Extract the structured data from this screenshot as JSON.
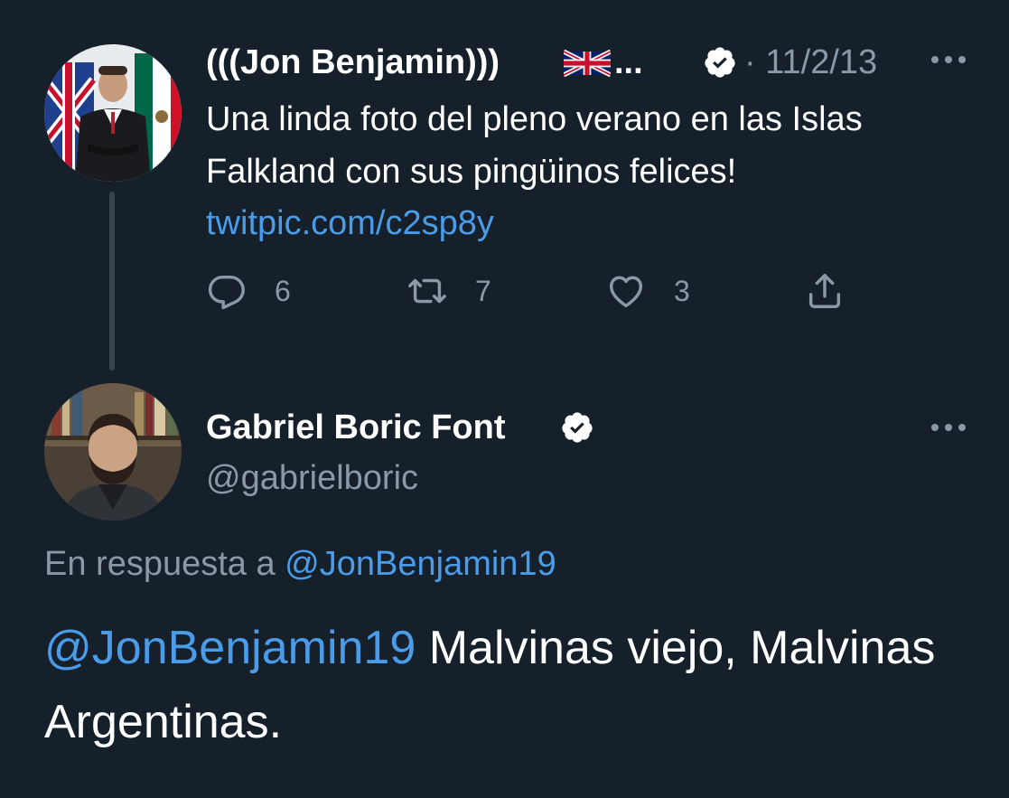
{
  "colors": {
    "background": "#15202b",
    "text_primary": "#ffffff",
    "text_secondary": "#8b98a5",
    "link": "#4a9ce8",
    "thread_line": "#38444d"
  },
  "parent_tweet": {
    "author_name": "(((Jon Benjamin)))",
    "name_flag_icon": "uk-flag-emoji",
    "name_ellipsis": "...",
    "verified_icon": "verified-badge-icon",
    "date": "· 11/2/13",
    "text": "Una linda foto del pleno verano en las Islas Falkland con sus pingüinos felices!",
    "link": "twitpic.com/c2sp8y",
    "actions": {
      "reply": {
        "icon": "reply-icon",
        "count": "6"
      },
      "retweet": {
        "icon": "retweet-icon",
        "count": "7"
      },
      "like": {
        "icon": "heart-icon",
        "count": "3"
      },
      "share": {
        "icon": "share-icon"
      }
    }
  },
  "reply_tweet": {
    "author_name": "Gabriel Boric Font",
    "handle": "@gabrielboric",
    "in_reply_prefix": "En respuesta a",
    "in_reply_mention": "@JonBenjamin19",
    "mention": "@JonBenjamin19",
    "text": " Malvinas viejo, Malvinas Argentinas."
  }
}
